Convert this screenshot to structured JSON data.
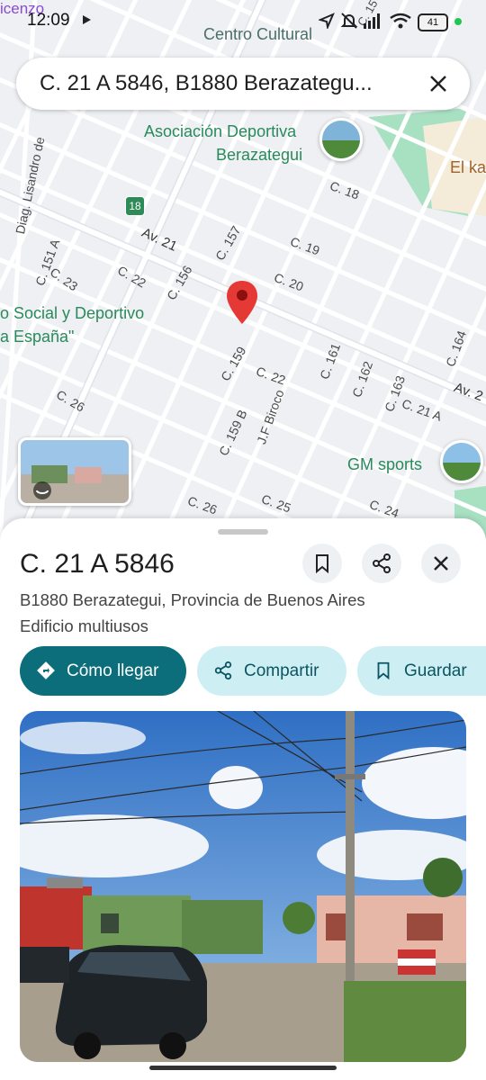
{
  "status_bar": {
    "time": "12:09",
    "battery": "41"
  },
  "search": {
    "query": "C. 21 A 5846, B1880 Berazategu..."
  },
  "map": {
    "streets": [
      "C. 18",
      "Av. 21",
      "C. 157",
      "C. 19",
      "C. 22",
      "C. 156",
      "C. 20",
      "C. 23",
      "C. 151 A",
      "Diag. Lisandro de",
      "C. 159",
      "C. 22",
      "C. 161",
      "C. 162",
      "C. 163",
      "C. 21 A",
      "C. 164",
      "Av. 2",
      "C. 26",
      "C. 159 B",
      "J.F Biroco",
      "C. 26",
      "C. 25",
      "C. 24",
      "C. 15"
    ],
    "pois": [
      "Centro Cultural",
      "Asociación Deportiva",
      "Berazategui",
      "El ka",
      "o Social y Deportivo",
      "a España\"",
      "GM sports",
      "icenzo"
    ],
    "route_shield": "18",
    "colors": {
      "pin": "#e53935",
      "park": "#a8e0c2",
      "poi_text": "#2a8a5c"
    }
  },
  "place": {
    "title": "C. 21 A 5846",
    "address": "B1880 Berazategui, Provincia de Buenos Aires",
    "category": "Edificio multiusos"
  },
  "actions": {
    "directions": "Cómo llegar",
    "share": "Compartir",
    "save": "Guardar"
  },
  "colors": {
    "primary": "#0b6e7a",
    "chip_bg": "#cdeff4",
    "chip_text": "#0b5562"
  }
}
